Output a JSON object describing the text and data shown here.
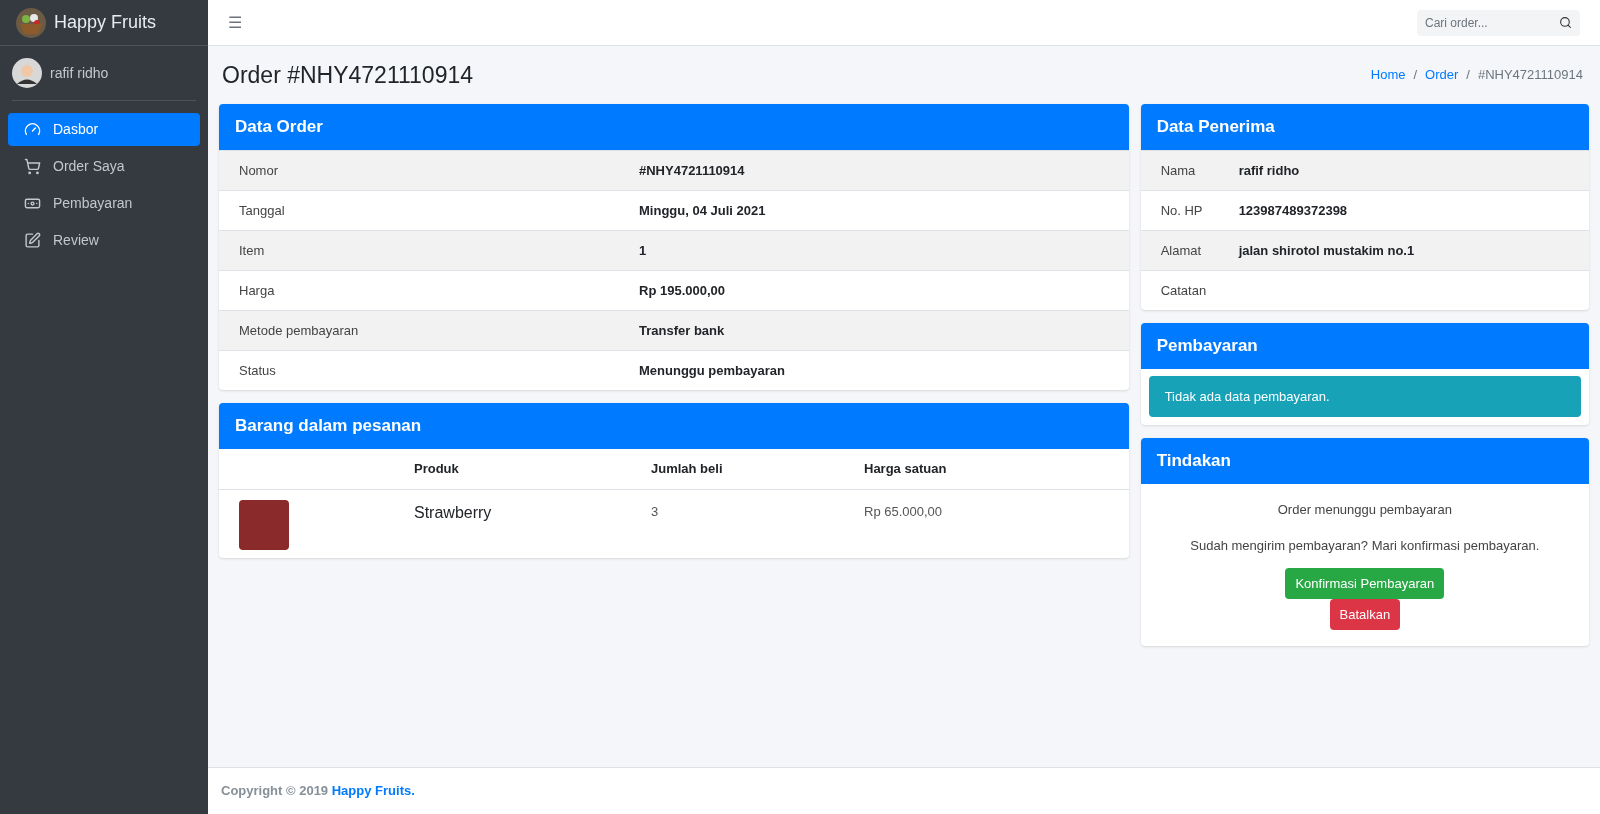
{
  "brand": {
    "name": "Happy Fruits"
  },
  "user": {
    "name": "rafif ridho"
  },
  "sidebar": {
    "items": [
      {
        "label": "Dasbor",
        "kind": "gauge",
        "selected": true
      },
      {
        "label": "Order Saya",
        "kind": "cart",
        "selected": false
      },
      {
        "label": "Pembayaran",
        "kind": "money",
        "selected": false
      },
      {
        "label": "Review",
        "kind": "edit",
        "selected": false
      }
    ]
  },
  "topbar": {
    "menu_icon": "☰",
    "search": {
      "placeholder": "Cari order..."
    }
  },
  "page": {
    "title": "Order #NHY4721110914",
    "breadcrumb_separator": "/",
    "breadcrumb": [
      {
        "label": "Home",
        "link": true
      },
      {
        "label": "Order",
        "link": true
      },
      {
        "label": "#NHY4721110914",
        "link": false
      }
    ]
  },
  "data_order": {
    "title": "Data Order",
    "rows": [
      {
        "label": "Nomor",
        "value": "#NHY4721110914"
      },
      {
        "label": "Tanggal",
        "value": "Minggu, 04 Juli 2021"
      },
      {
        "label": "Item",
        "value": "1"
      },
      {
        "label": "Harga",
        "value": "Rp 195.000,00"
      },
      {
        "label": "Metode pembayaran",
        "value": "Transfer bank"
      },
      {
        "label": "Status",
        "value": "Menunggu pembayaran"
      }
    ]
  },
  "items": {
    "title": "Barang dalam pesanan",
    "columns": [
      "Produk",
      "Jumlah beli",
      "Harga satuan"
    ],
    "rows": [
      {
        "product": "Strawberry",
        "quantity": "3",
        "price": "Rp 65.000,00"
      }
    ]
  },
  "recipient": {
    "title": "Data Penerima",
    "rows": [
      {
        "label": "Nama",
        "value": "rafif ridho"
      },
      {
        "label": "No. HP",
        "value": "123987489372398"
      },
      {
        "label": "Alamat",
        "value": "jalan shirotol mustakim no.1"
      },
      {
        "label": "Catatan"
      }
    ]
  },
  "payment": {
    "title": "Pembayaran",
    "alert": "Tidak ada data pembayaran."
  },
  "actions": {
    "title": "Tindakan",
    "status": "Order menunggu pembayaran",
    "prompt": "Sudah mengirim pembayaran? Mari konfirmasi pembayaran.",
    "buttons": [
      {
        "label": "Konfirmasi Pembayaran",
        "kind": "success"
      },
      {
        "label": "Batalkan",
        "kind": "danger"
      }
    ]
  },
  "footer": {
    "text": "Copyright © 2019",
    "link": "Happy Fruits."
  }
}
